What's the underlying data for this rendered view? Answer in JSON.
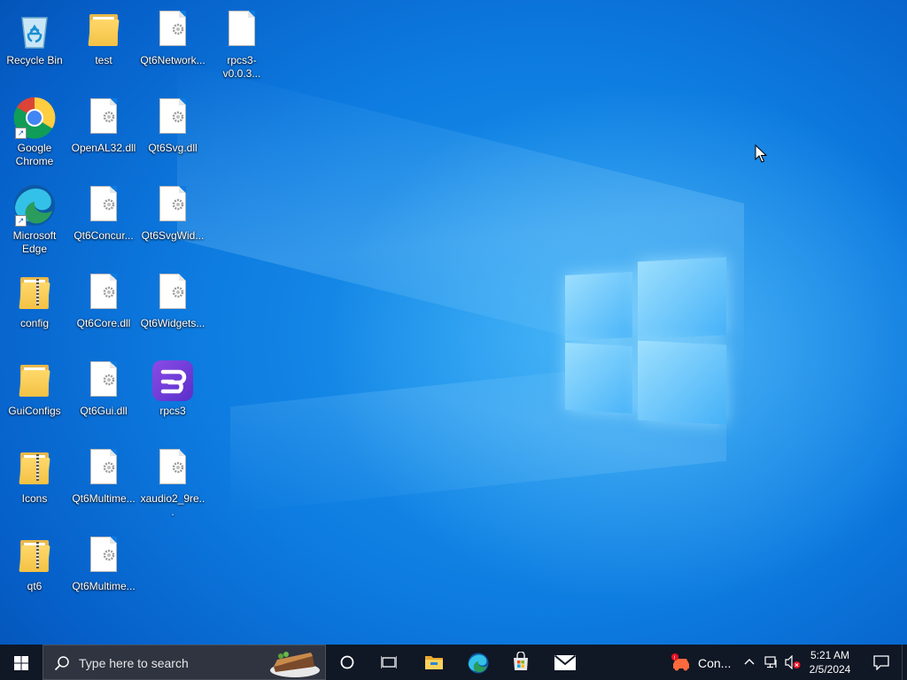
{
  "desktop": {
    "icons": [
      {
        "label": "Recycle Bin",
        "kind": "recycle-bin"
      },
      {
        "label": "test",
        "kind": "folder"
      },
      {
        "label": "Qt6Network...",
        "kind": "dll-file"
      },
      {
        "label": "rpcs3-v0.0.3...",
        "kind": "blank-file"
      },
      {
        "label": "Google\nChrome",
        "kind": "chrome"
      },
      {
        "label": "OpenAL32.dll",
        "kind": "dll-file"
      },
      {
        "label": "Qt6Svg.dll",
        "kind": "dll-file"
      },
      {
        "label": "Microsoft\nEdge",
        "kind": "edge"
      },
      {
        "label": "Qt6Concur...",
        "kind": "dll-file"
      },
      {
        "label": "Qt6SvgWid...",
        "kind": "dll-file"
      },
      {
        "label": "config",
        "kind": "folder-zip"
      },
      {
        "label": "Qt6Core.dll",
        "kind": "dll-file"
      },
      {
        "label": "Qt6Widgets...",
        "kind": "dll-file"
      },
      {
        "label": "GuiConfigs",
        "kind": "folder"
      },
      {
        "label": "Qt6Gui.dll",
        "kind": "dll-file"
      },
      {
        "label": "rpcs3",
        "kind": "rpcs3-app"
      },
      {
        "label": "Icons",
        "kind": "folder-zip"
      },
      {
        "label": "Qt6Multime...",
        "kind": "dll-file"
      },
      {
        "label": "xaudio2_9re...",
        "kind": "dll-file"
      },
      {
        "label": "qt6",
        "kind": "folder-zip"
      },
      {
        "label": "Qt6Multime...",
        "kind": "dll-file"
      }
    ]
  },
  "taskbar": {
    "search_placeholder": "Type here to search",
    "pinned": [
      "cortana-icon",
      "task-view-icon",
      "file-explorer-icon",
      "edge-icon",
      "store-icon",
      "mail-icon"
    ],
    "tray_app_label": "Con...",
    "time": "5:21 AM",
    "date": "2/5/2024"
  },
  "colors": {
    "taskbar": "#101725",
    "search_box": "#2f3440",
    "desktop_blue": "#0d7be0",
    "accent": "#0078d7"
  }
}
